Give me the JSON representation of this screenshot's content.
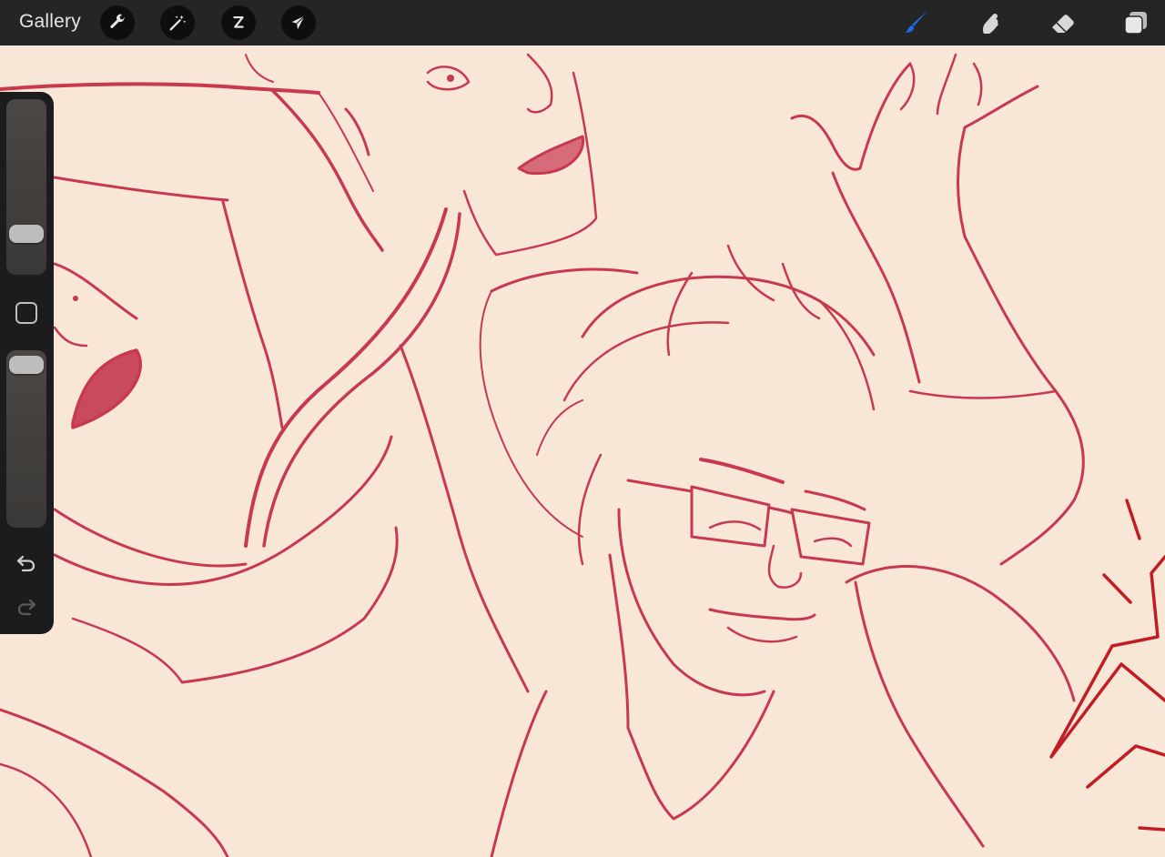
{
  "toolbar": {
    "gallery_label": "Gallery",
    "left_tools": [
      {
        "name": "actions",
        "icon": "wrench-icon"
      },
      {
        "name": "adjustments",
        "icon": "magic-wand-icon"
      },
      {
        "name": "selection",
        "icon": "selection-s-icon"
      },
      {
        "name": "transform",
        "icon": "arrow-cursor-icon"
      }
    ],
    "right_tools": [
      {
        "name": "brush",
        "icon": "brush-icon",
        "active": true
      },
      {
        "name": "smudge",
        "icon": "smudge-finger-icon",
        "active": false
      },
      {
        "name": "eraser",
        "icon": "eraser-icon",
        "active": false
      },
      {
        "name": "layers",
        "icon": "layers-icon",
        "active": false
      }
    ],
    "active_color": "#1a6fe8"
  },
  "sidebar": {
    "brush_size_level": 0.74,
    "opacity_level": 0.05,
    "modify_icon": "square-icon",
    "undo_icon": "undo-arrow-icon",
    "redo_icon": "redo-arrow-icon"
  },
  "canvas": {
    "background_color": "#f8e7d7",
    "sketch_color": "#c8394d",
    "accent_stroke_color": "#c21d24",
    "subject": "line-art-sketch"
  }
}
